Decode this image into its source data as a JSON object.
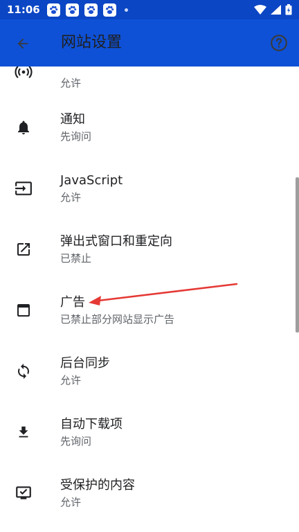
{
  "status_bar": {
    "time": "11:06",
    "notification_icons": [
      "baidu-paw-icon",
      "baidu-paw-icon",
      "baidu-paw-icon",
      "baidu-paw-icon"
    ],
    "colors": {
      "background": "#0b46c4"
    }
  },
  "app_bar": {
    "title": "网站设置",
    "colors": {
      "background": "#0e51d6"
    }
  },
  "settings": [
    {
      "icon": "sensor-icon",
      "title": "",
      "summary": "允许"
    },
    {
      "icon": "bell-icon",
      "title": "通知",
      "summary": "先询问"
    },
    {
      "icon": "javascript-icon",
      "title": "JavaScript",
      "summary": "允许"
    },
    {
      "icon": "open-in-new-icon",
      "title": "弹出式窗口和重定向",
      "summary": "已禁止"
    },
    {
      "icon": "ads-window-icon",
      "title": "广告",
      "summary": "已禁止部分网站显示广告"
    },
    {
      "icon": "sync-icon",
      "title": "后台同步",
      "summary": "允许"
    },
    {
      "icon": "download-icon",
      "title": "自动下载项",
      "summary": "先询问"
    },
    {
      "icon": "protected-content-icon",
      "title": "受保护的内容",
      "summary": "允许"
    }
  ],
  "annotation": {
    "color": "#e53935"
  }
}
